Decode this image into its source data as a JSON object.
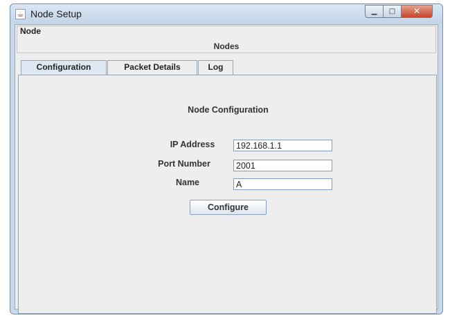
{
  "window": {
    "title": "Node Setup",
    "icons": {
      "app": "java-cup-icon",
      "minimize": "minimize-icon",
      "maximize": "maximize-icon",
      "close": "close-icon"
    }
  },
  "node_panel": {
    "legend": "Node",
    "heading": "Nodes"
  },
  "tabs": [
    {
      "label": "Configuration",
      "active": true
    },
    {
      "label": "Packet Details",
      "active": false
    },
    {
      "label": "Log",
      "active": false
    }
  ],
  "config": {
    "title": "Node Configuration",
    "fields": [
      {
        "label": "IP Address",
        "value": "192.168.1.1"
      },
      {
        "label": "Port Number",
        "value": "2001"
      },
      {
        "label": "Name",
        "value": "A"
      }
    ],
    "button": "Configure"
  }
}
